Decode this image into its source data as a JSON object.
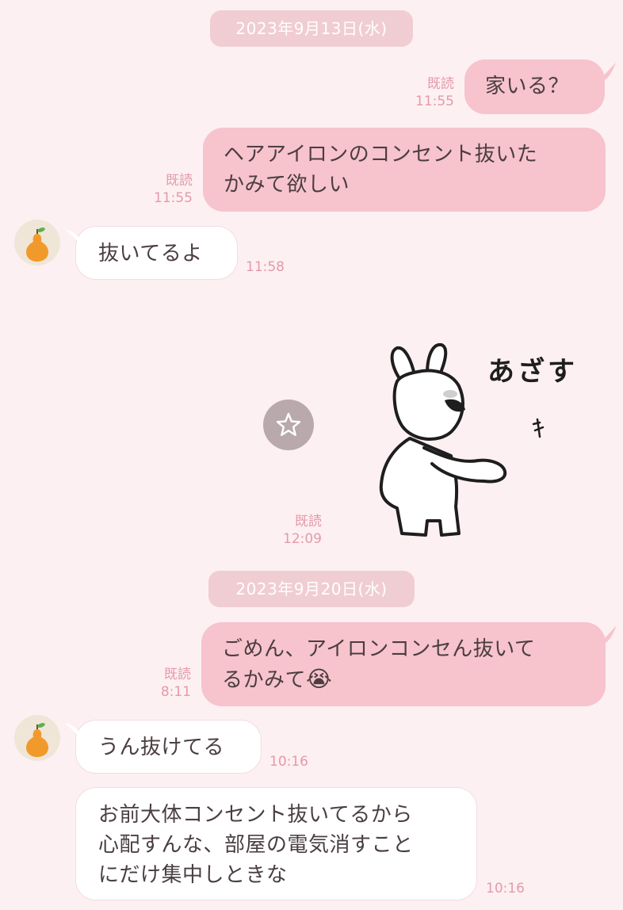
{
  "dates": [
    "2023年9月13日(水)",
    "2023年9月20日(水)"
  ],
  "messages": [
    {
      "text": "家いる？",
      "read": "既読",
      "time": "11:55"
    },
    {
      "line1": "ヘアアイロンのコンセント抜いた",
      "line2": "かみて欲しい",
      "read": "既読",
      "time": "11:55"
    },
    {
      "text": "抜いてるよ",
      "time": "11:58"
    },
    {
      "sticker_text": "あざす",
      "read": "既読",
      "time": "12:09"
    },
    {
      "line1": "ごめん、アイロンコンセん抜いて",
      "line2": "るかみて",
      "emoji": "😭",
      "read": "既読",
      "time": "8:11"
    },
    {
      "text": "うん抜けてる",
      "time": "10:16"
    },
    {
      "line1": "お前大体コンセント抜いてるから",
      "line2": "心配すんな、部屋の電気消すこと",
      "line3": "にだけ集中しときな",
      "time": "10:16"
    }
  ],
  "icons": {
    "avatar": "pear-icon",
    "favorite": "star-icon"
  },
  "colors": {
    "background": "#fdf0f2",
    "outgoing_bubble": "#f7c3cd",
    "incoming_bubble": "#ffffff",
    "date_pill": "#f0cdd3",
    "meta_text": "#e49aab"
  }
}
